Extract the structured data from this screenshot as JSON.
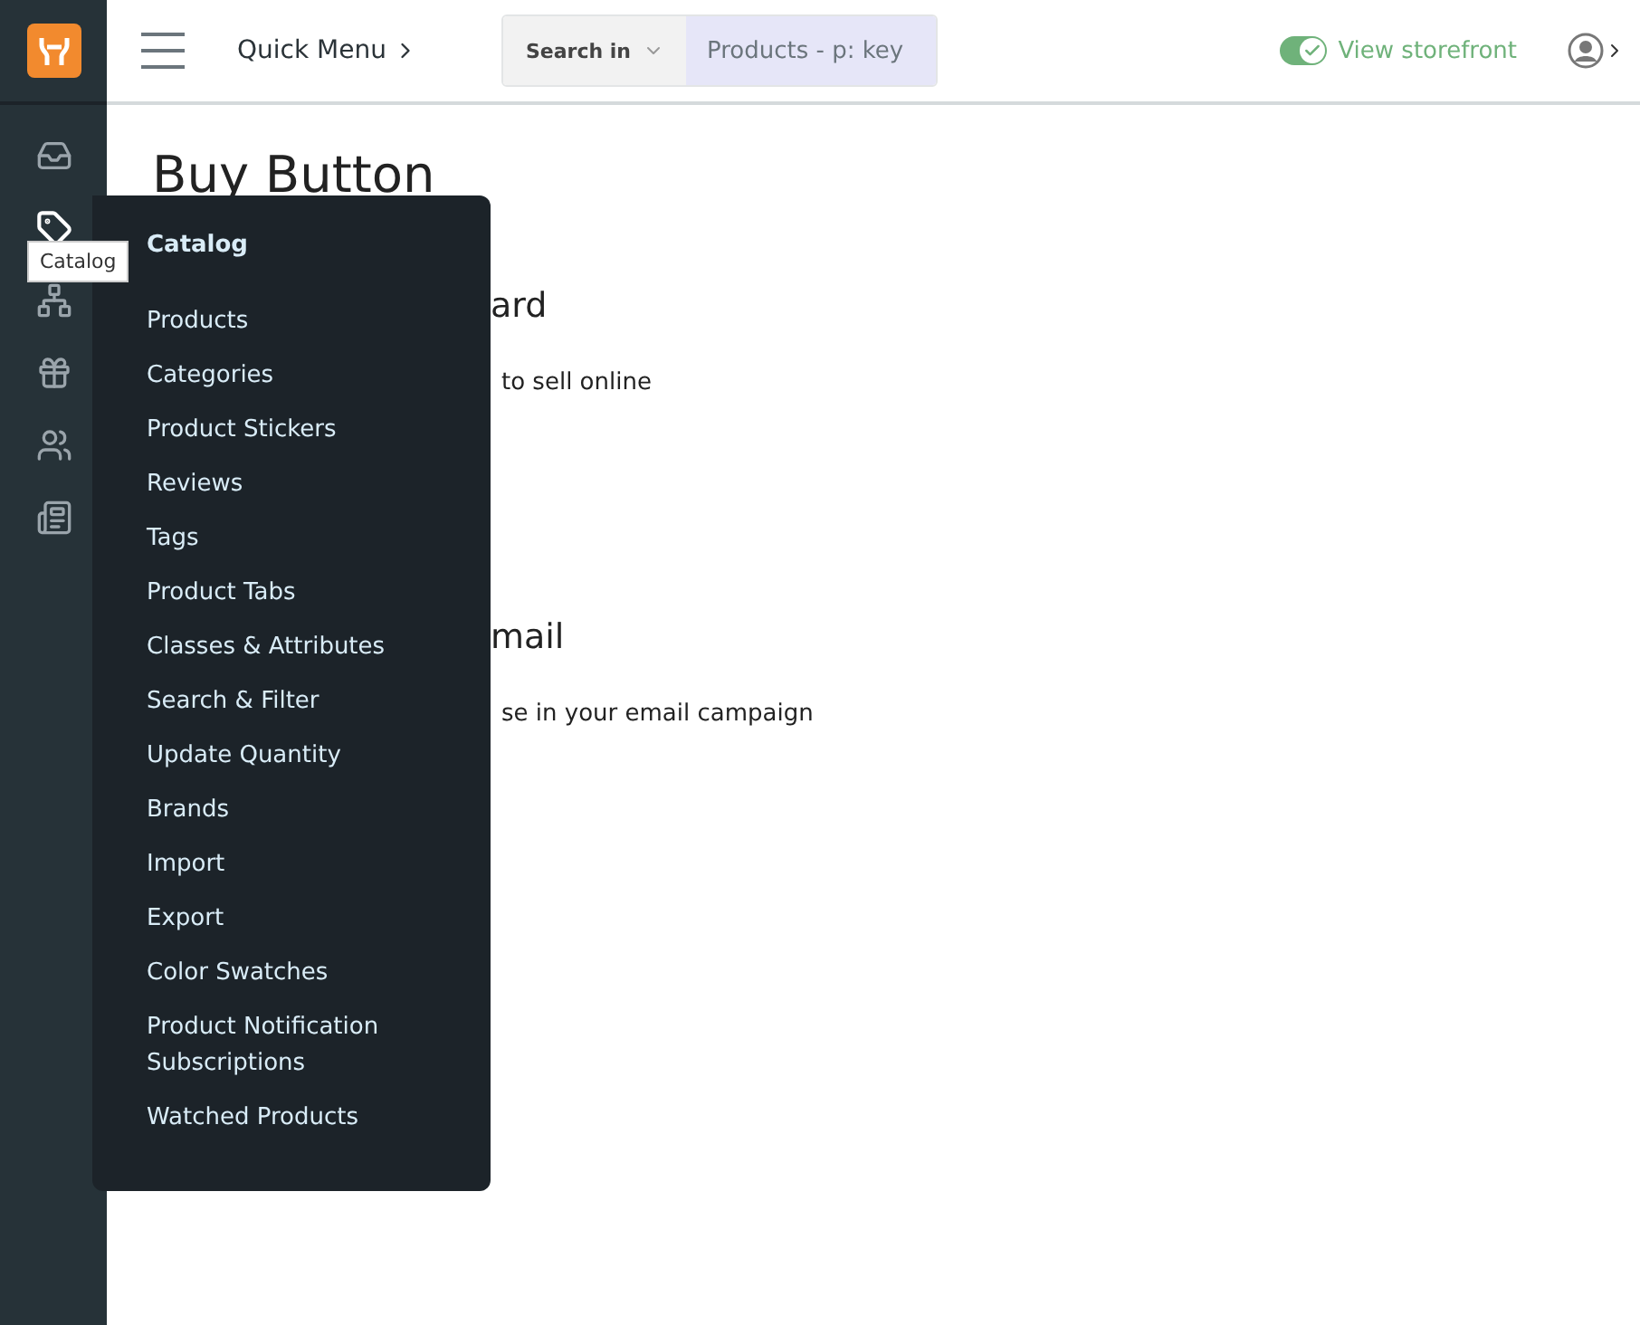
{
  "topbar": {
    "quick_menu": "Quick Menu",
    "search": {
      "scope": "Search in",
      "placeholder": "Products - p: key"
    },
    "storefront": {
      "label": "View storefront",
      "on": true
    }
  },
  "sidebar": {
    "items": [
      {
        "kind": "inbox",
        "selected": false
      },
      {
        "kind": "tag",
        "selected": true
      },
      {
        "kind": "network",
        "selected": false
      },
      {
        "kind": "gift",
        "selected": false
      },
      {
        "kind": "users",
        "selected": false
      },
      {
        "kind": "news",
        "selected": false
      }
    ],
    "tooltip": "Catalog"
  },
  "page": {
    "title": "Buy Button",
    "sections": [
      {
        "heading": "ard",
        "text": "to sell online"
      },
      {
        "heading": "mail",
        "text": "se in your email campaign"
      }
    ]
  },
  "flyout": {
    "title": "Catalog",
    "items": [
      "Products",
      "Categories",
      "Product Stickers",
      "Reviews",
      "Tags",
      "Product Tabs",
      "Classes & Attributes",
      "Search & Filter",
      "Update Quantity",
      "Brands",
      "Import",
      "Export",
      "Color Swatches",
      "Product Notification Subscriptions",
      "Watched Products"
    ]
  }
}
